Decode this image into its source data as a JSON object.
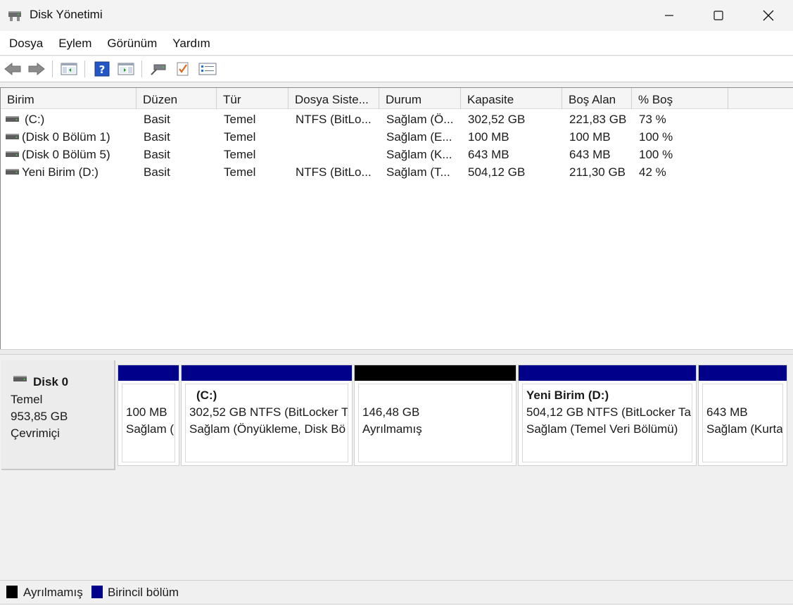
{
  "window": {
    "title": "Disk Yönetimi"
  },
  "menu": [
    "Dosya",
    "Eylem",
    "Görünüm",
    "Yardım"
  ],
  "toolbar": {
    "buttons": [
      "back-arrow-icon",
      "forward-arrow-icon",
      "show-hide-console-tree-icon",
      "help-icon",
      "show-hide-action-pane-icon",
      "connect-disk-icon",
      "check-properties-icon",
      "list-view-icon"
    ]
  },
  "volume_table": {
    "columns": [
      "Birim",
      "Düzen",
      "Tür",
      "Dosya Siste...",
      "Durum",
      "Kapasite",
      "Boş Alan",
      "% Boş"
    ],
    "rows": [
      {
        "birim": "(C:)",
        "duzen": "Basit",
        "tur": "Temel",
        "dosya": "NTFS (BitLo...",
        "durum": "Sağlam (Ö...",
        "kapasite": "302,52 GB",
        "bos": "221,83 GB",
        "yuzde": "73 %"
      },
      {
        "birim": "(Disk 0 Bölüm 1)",
        "duzen": "Basit",
        "tur": "Temel",
        "dosya": "",
        "durum": "Sağlam (E...",
        "kapasite": "100 MB",
        "bos": "100 MB",
        "yuzde": "100 %"
      },
      {
        "birim": "(Disk 0 Bölüm 5)",
        "duzen": "Basit",
        "tur": "Temel",
        "dosya": "",
        "durum": "Sağlam (K...",
        "kapasite": "643 MB",
        "bos": "643 MB",
        "yuzde": "100 %"
      },
      {
        "birim": "Yeni Birim (D:)",
        "duzen": "Basit",
        "tur": "Temel",
        "dosya": "NTFS (BitLo...",
        "durum": "Sağlam (T...",
        "kapasite": "504,12 GB",
        "bos": "211,30 GB",
        "yuzde": "42 %"
      }
    ]
  },
  "disk": {
    "name": "Disk 0",
    "type": "Temel",
    "size": "953,85 GB",
    "status": "Çevrimiçi",
    "partitions": [
      {
        "title": "",
        "line1": "100 MB",
        "line2": "Sağlam (",
        "kind": "primary"
      },
      {
        "title": "(C:)",
        "line1": "302,52 GB NTFS (BitLocker T",
        "line2": "Sağlam (Önyükleme, Disk Bö",
        "kind": "primary"
      },
      {
        "title": "",
        "line1": "146,48 GB",
        "line2": "Ayrılmamış",
        "kind": "unallocated"
      },
      {
        "title": "Yeni Birim  (D:)",
        "line1": "504,12 GB NTFS (BitLocker Ta",
        "line2": "Sağlam (Temel Veri Bölümü)",
        "kind": "primary"
      },
      {
        "title": "",
        "line1": "643 MB",
        "line2": "Sağlam (Kurta",
        "kind": "primary"
      }
    ]
  },
  "legend": {
    "unallocated": "Ayrılmamış",
    "primary": "Birincil bölüm"
  },
  "colors": {
    "primary_bar": "#00008b",
    "unallocated_bar": "#000000"
  }
}
